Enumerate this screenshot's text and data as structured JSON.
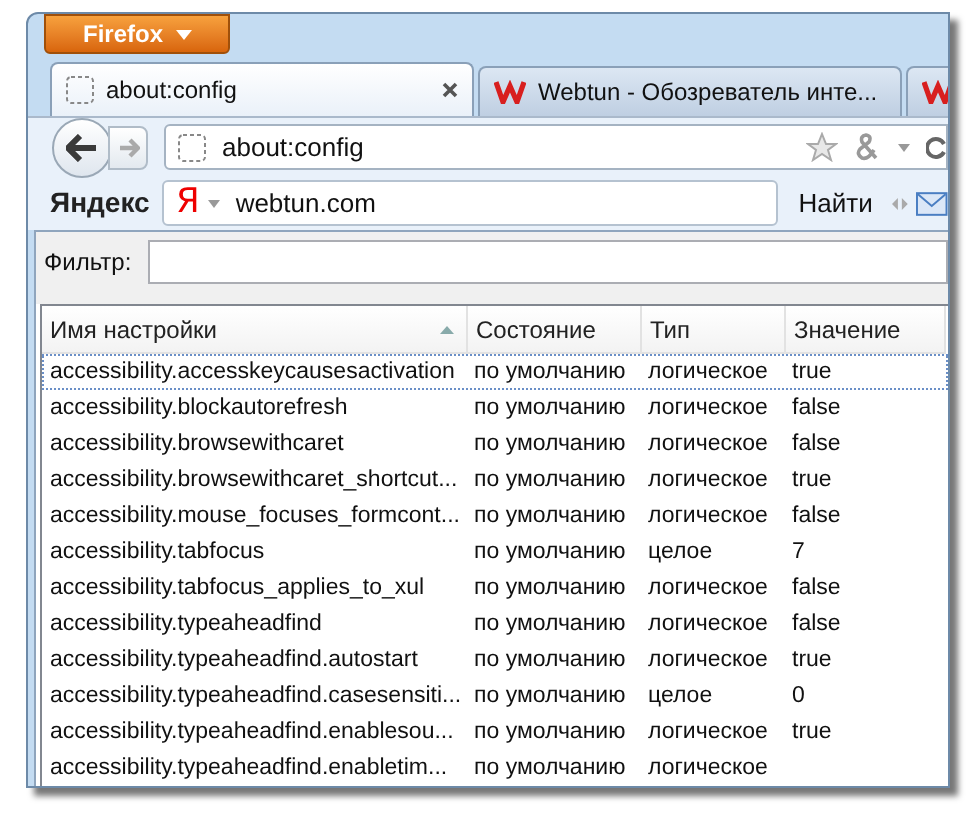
{
  "app_button": {
    "label": "Firefox"
  },
  "tabs": [
    {
      "kind": "blank",
      "title": "about:config",
      "selected": true
    },
    {
      "kind": "site",
      "title": "Webtun - Обозреватель инте...",
      "selected": false
    },
    {
      "kind": "site",
      "selected": false
    }
  ],
  "address_bar": {
    "value": "about:config"
  },
  "search_toolbar": {
    "brand": "Яндекс",
    "engine_logo": "Я",
    "value": "webtun.com",
    "button": "Найти"
  },
  "filter": {
    "label": "Фильтр:"
  },
  "table": {
    "columns": [
      "Имя настройки",
      "Состояние",
      "Тип",
      "Значение"
    ],
    "rows": [
      {
        "focused": true,
        "cells": [
          "accessibility.accesskeycausesactivation",
          "по умолчанию",
          "логическое",
          "true"
        ]
      },
      {
        "focused": false,
        "cells": [
          "accessibility.blockautorefresh",
          "по умолчанию",
          "логическое",
          "false"
        ]
      },
      {
        "focused": false,
        "cells": [
          "accessibility.browsewithcaret",
          "по умолчанию",
          "логическое",
          "false"
        ]
      },
      {
        "focused": false,
        "cells": [
          "accessibility.browsewithcaret_shortcut...",
          "по умолчанию",
          "логическое",
          "true"
        ]
      },
      {
        "focused": false,
        "cells": [
          "accessibility.mouse_focuses_formcont...",
          "по умолчанию",
          "логическое",
          "false"
        ]
      },
      {
        "focused": false,
        "cells": [
          "accessibility.tabfocus",
          "по умолчанию",
          "целое",
          "7"
        ]
      },
      {
        "focused": false,
        "cells": [
          "accessibility.tabfocus_applies_to_xul",
          "по умолчанию",
          "логическое",
          "false"
        ]
      },
      {
        "focused": false,
        "cells": [
          "accessibility.typeaheadfind",
          "по умолчанию",
          "логическое",
          "false"
        ]
      },
      {
        "focused": false,
        "cells": [
          "accessibility.typeaheadfind.autostart",
          "по умолчанию",
          "логическое",
          "true"
        ]
      },
      {
        "focused": false,
        "cells": [
          "accessibility.typeaheadfind.casesensiti...",
          "по умолчанию",
          "целое",
          "0"
        ]
      },
      {
        "focused": false,
        "cells": [
          "accessibility.typeaheadfind.enablesou...",
          "по умолчанию",
          "логическое",
          "true"
        ]
      },
      {
        "focused": false,
        "cells": [
          "accessibility.typeaheadfind.enabletim...",
          "по умолчанию",
          "логическое"
        ]
      }
    ]
  }
}
